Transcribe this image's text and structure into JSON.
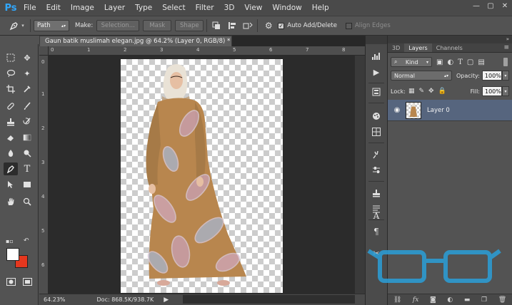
{
  "app": {
    "logo": "Ps"
  },
  "menu": [
    "File",
    "Edit",
    "Image",
    "Layer",
    "Type",
    "Select",
    "Filter",
    "3D",
    "View",
    "Window",
    "Help"
  ],
  "window_controls": {
    "minimize": "—",
    "restore": "▢",
    "close": "✕"
  },
  "options_bar": {
    "mode_value": "Path",
    "make_label": "Make:",
    "selection_label": "Selection...",
    "mask_label": "Mask",
    "shape_label": "Shape",
    "auto_add_delete_label": "Auto Add/Delete",
    "auto_add_delete_checked": true,
    "align_edges_label": "Align Edges",
    "align_edges_checked": false
  },
  "document": {
    "tab_title": "Gaun batik muslimah elegan.jpg @ 64.2% (Layer 0, RGB/8) *",
    "zoom": "64.23%",
    "doc_info": "Doc: 868.5K/938.7K"
  },
  "rulers": {
    "top": [
      "0",
      "1",
      "2",
      "3",
      "4",
      "5",
      "6",
      "7",
      "8"
    ],
    "left": [
      "0",
      "1",
      "2",
      "3",
      "4",
      "5",
      "6",
      "7"
    ]
  },
  "layers_panel": {
    "tabs": [
      "3D",
      "Layers",
      "Channels"
    ],
    "active_tab": "Layers",
    "filter_kind": "Kind",
    "blend_mode": "Normal",
    "opacity_label": "Opacity:",
    "opacity_value": "100%",
    "lock_label": "Lock:",
    "fill_label": "Fill:",
    "fill_value": "100%",
    "layers": [
      {
        "name": "Layer 0",
        "visible": true
      }
    ],
    "footer_icons": [
      "link-icon",
      "fx-icon",
      "mask-icon",
      "adjustment-icon",
      "folder-icon",
      "new-layer-icon",
      "trash-icon"
    ]
  },
  "colors": {
    "foreground": "#ffffff",
    "background": "#e5371e",
    "accent": "#31a8ff",
    "selected_layer": "#56657e"
  }
}
